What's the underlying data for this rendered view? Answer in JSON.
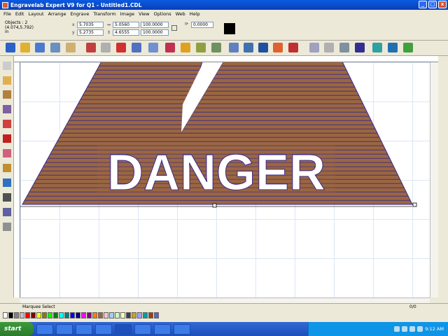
{
  "window": {
    "title": "Engravelab Expert V9 for Q1 - Untitled1.CDL",
    "min": "_",
    "max": "□",
    "close": "x"
  },
  "menu": [
    "File",
    "Edit",
    "Layout",
    "Arrange",
    "Engrave",
    "Transform",
    "Image",
    "View",
    "Options",
    "Web",
    "Help"
  ],
  "properties": {
    "objects_label": "Objects : 2",
    "position": "(4.074,5.792)",
    "units": "in",
    "x": "5.7035",
    "y": "5.2735",
    "width": "5.0560",
    "height": "4.6555",
    "scale_x": "100.0000",
    "scale_y": "100.0000",
    "rotation": "0.0000"
  },
  "canvas": {
    "text": "DANGER",
    "fill_color": "#9b6640",
    "line_color": "#3b2a8a",
    "text_color": "#ffffff"
  },
  "status": {
    "text": "Marquee Select",
    "page": "0/0"
  },
  "taskbar": {
    "start": "start",
    "clock": "9:12 AM"
  },
  "colors": {
    "titlebar": "#0a4fd0",
    "taskbar": "#245edb",
    "start": "#3a9a3a"
  }
}
